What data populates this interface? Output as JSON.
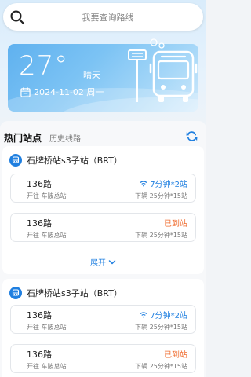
{
  "search": {
    "placeholder": "我要查询路线"
  },
  "weather": {
    "temperature": "27°",
    "condition": "晴天",
    "date": "2024-11-02 周一"
  },
  "tabs": {
    "active": "热门站点",
    "other": "历史线路"
  },
  "stations": [
    {
      "name": "石牌桥站s3子站（BRT）",
      "routes": [
        {
          "number": "136路",
          "destination": "开往 车陂总站",
          "eta": "7分钟*2站",
          "eta_status": "arriving",
          "next": "下辆 25分钟*15站"
        },
        {
          "number": "136路",
          "destination": "开往 车陂总站",
          "eta": "已到站",
          "eta_status": "arrived",
          "next": "下辆 25分钟*15站"
        }
      ],
      "expand_label": "展开"
    },
    {
      "name": "石牌桥站s3子站（BRT）",
      "routes": [
        {
          "number": "136路",
          "destination": "开往 车陂总站",
          "eta": "7分钟*2站",
          "eta_status": "arriving",
          "next": "下辆 25分钟*15站"
        },
        {
          "number": "136路",
          "destination": "开往 车陂总站",
          "eta": "已到站",
          "eta_status": "arrived",
          "next": "下辆 25分钟*15站"
        }
      ]
    }
  ],
  "colors": {
    "accent": "#1f7fe0",
    "arrived": "#ef6b2e",
    "weather_card": "#6cb8f1"
  },
  "icons": [
    "search-icon",
    "calendar-icon",
    "bus-stop-sign-icon",
    "bus-icon",
    "refresh-icon",
    "bus-badge-icon",
    "signal-icon",
    "chevron-down-icon"
  ]
}
